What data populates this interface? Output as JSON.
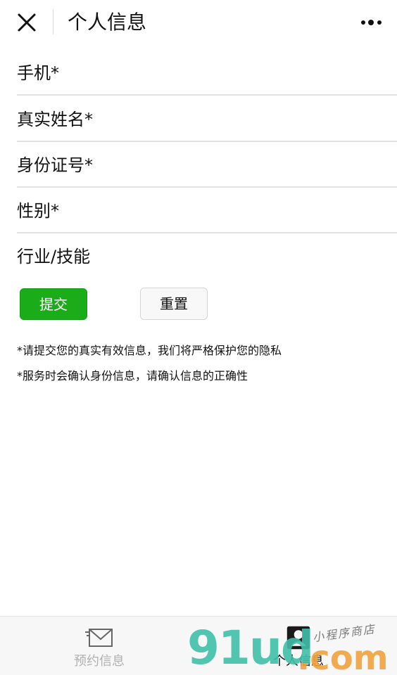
{
  "header": {
    "title": "个人信息",
    "close_icon": "close-icon",
    "more_icon": "more-dots-icon"
  },
  "form": {
    "fields": [
      {
        "label": "手机*",
        "value": "",
        "placeholder": ""
      },
      {
        "label": "真实姓名*",
        "value": "",
        "placeholder": ""
      },
      {
        "label": "身份证号*",
        "value": "",
        "placeholder": ""
      },
      {
        "label": "性别*",
        "value": "",
        "placeholder": ""
      },
      {
        "label": "行业/技能",
        "value": "",
        "placeholder": ""
      }
    ],
    "submit_label": "提交",
    "reset_label": "重置",
    "submit_color": "#1aad19"
  },
  "notices": [
    "*请提交您的真实有效信息，我们将严格保护您的隐私",
    "*服务时会确认身份信息，请确认信息的正确性"
  ],
  "tabbar": {
    "tabs": [
      {
        "label": "预约信息",
        "icon": "envelope-icon",
        "active": false
      },
      {
        "label": "个人信息",
        "icon": "profile-card-icon",
        "active": true
      }
    ]
  },
  "watermark": {
    "brand": "91ud",
    "tld": ".com",
    "tagline": "小程序商店"
  }
}
